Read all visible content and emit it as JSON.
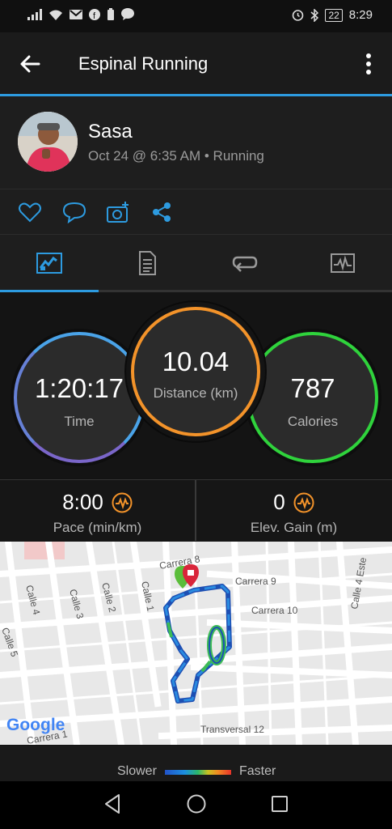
{
  "statusbar": {
    "battery": "22",
    "time": "8:29"
  },
  "appbar": {
    "title": "Espinal Running"
  },
  "profile": {
    "name": "Sasa",
    "meta": "Oct 24 @ 6:35 AM • Running"
  },
  "stats": {
    "time": {
      "value": "1:20:17",
      "label": "Time"
    },
    "distance": {
      "value": "10.04",
      "label": "Distance (km)"
    },
    "calories": {
      "value": "787",
      "label": "Calories"
    }
  },
  "metrics": {
    "pace": {
      "value": "8:00",
      "label": "Pace (min/km)"
    },
    "elev": {
      "value": "0",
      "label": "Elev. Gain (m)"
    }
  },
  "map": {
    "streets": [
      "Calle 4",
      "Calle 3",
      "Calle 2",
      "Calle 1",
      "Carrera 8",
      "Carrera 9",
      "Carrera 10",
      "Calle 4 Este",
      "Calle 5",
      "Transversal 12",
      "Carrera 1"
    ],
    "provider": "Google"
  },
  "legend": {
    "slower": "Slower",
    "faster": "Faster"
  },
  "colors": {
    "accent": "#2d9be0",
    "time_ring": "#4aa3e8",
    "distance_ring": "#f3932a",
    "calories_ring": "#2fd33c"
  }
}
